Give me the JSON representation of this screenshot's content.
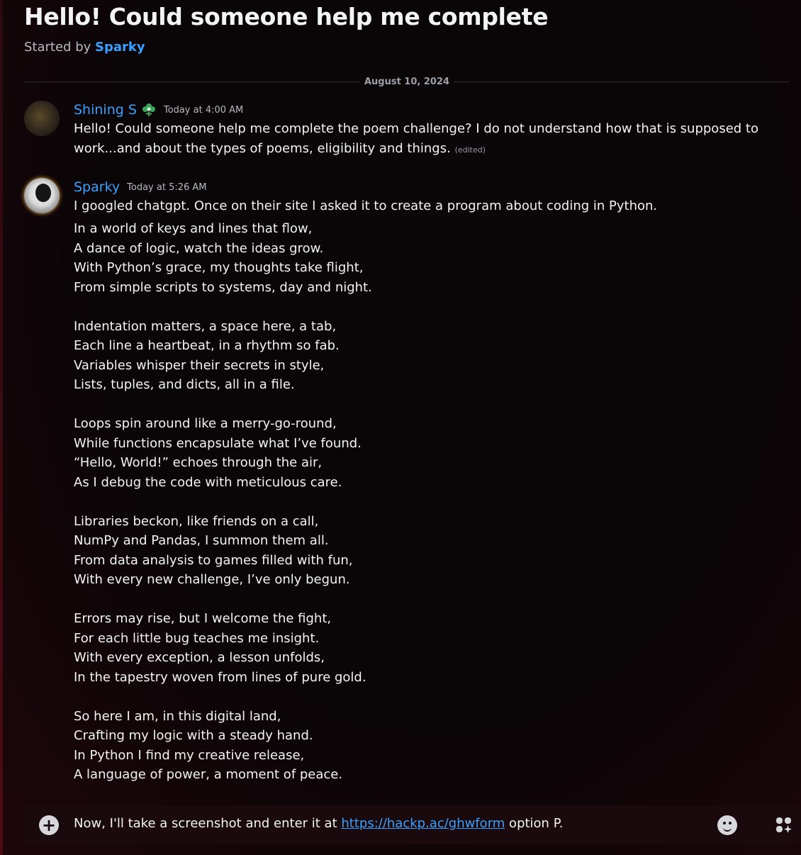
{
  "thread": {
    "title": "Hello! Could someone help me complete",
    "started_by_label": "Started by",
    "started_by_user": "Sparky"
  },
  "date_divider": "August 10, 2024",
  "messages": [
    {
      "username": "Shining S",
      "role_icon": "flower-role-icon",
      "timestamp": "Today at 4:00 AM",
      "text": "Hello! Could someone help me complete the poem challenge? I do not understand how that is supposed to work...and about the types of poems, eligibility and things.",
      "edited": "(edited)"
    },
    {
      "username": "Sparky",
      "timestamp": "Today at 5:26 AM",
      "text": "I googled chatgpt. Once on their site I asked it to create a program about coding in Python.",
      "poem": [
        [
          "In a world of keys and lines that flow,",
          "A dance of logic, watch the ideas grow.",
          "With Python’s grace, my thoughts take flight,",
          "From simple scripts to systems, day and night."
        ],
        [
          "Indentation matters, a space here, a tab,",
          "Each line a heartbeat, in a rhythm so fab.",
          "Variables whisper their secrets in style,",
          "Lists, tuples, and dicts, all in a file."
        ],
        [
          "Loops spin around like a merry-go-round,",
          "While functions encapsulate what I’ve found.",
          "“Hello, World!” echoes through the air,",
          "As I debug the code with meticulous care."
        ],
        [
          "Libraries beckon, like friends on a call,",
          "NumPy and Pandas, I summon them all.",
          "From data analysis to games filled with fun,",
          "With every new challenge, I’ve only begun."
        ],
        [
          "Errors may rise, but I welcome the fight,",
          "For each little bug teaches me insight.",
          "With every exception, a lesson unfolds,",
          "In the tapestry woven from lines of pure gold."
        ],
        [
          "So here I am, in this digital land,",
          "Crafting my logic with a steady hand.",
          "In Python I find my creative release,",
          "A language of power, a moment of peace."
        ]
      ]
    }
  ],
  "composer": {
    "text_before": "Now, I'll take a screenshot and enter it at ",
    "link": "https://hackp.ac/ghwform",
    "text_after": " option P."
  },
  "colors": {
    "link": "#3aa0ff",
    "text": "#f2f3f5",
    "role_icon": "#3ba55c"
  }
}
